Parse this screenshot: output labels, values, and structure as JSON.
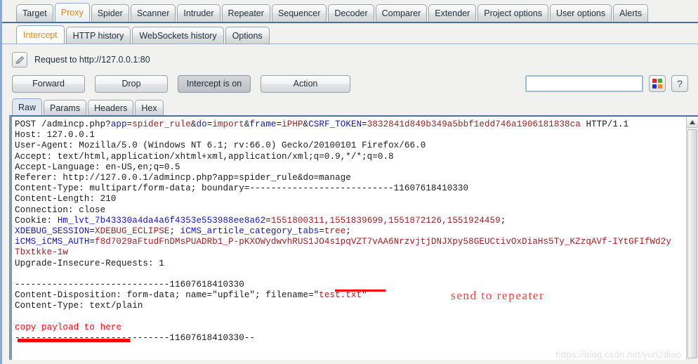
{
  "main_tabs": [
    {
      "label": "Target",
      "active": false
    },
    {
      "label": "Proxy",
      "active": true
    },
    {
      "label": "Spider",
      "active": false
    },
    {
      "label": "Scanner",
      "active": false
    },
    {
      "label": "Intruder",
      "active": false
    },
    {
      "label": "Repeater",
      "active": false
    },
    {
      "label": "Sequencer",
      "active": false
    },
    {
      "label": "Decoder",
      "active": false
    },
    {
      "label": "Comparer",
      "active": false
    },
    {
      "label": "Extender",
      "active": false
    },
    {
      "label": "Project options",
      "active": false
    },
    {
      "label": "User options",
      "active": false
    },
    {
      "label": "Alerts",
      "active": false
    }
  ],
  "sub_tabs": [
    {
      "label": "Intercept",
      "active": true
    },
    {
      "label": "HTTP history",
      "active": false
    },
    {
      "label": "WebSockets history",
      "active": false
    },
    {
      "label": "Options",
      "active": false
    }
  ],
  "toolbar": {
    "request_title": "Request to http://127.0.0.1:80",
    "forward_label": "Forward",
    "drop_label": "Drop",
    "intercept_label": "Intercept is on",
    "action_label": "Action",
    "search_value": "",
    "search_placeholder": "",
    "help_label": "?",
    "palette_colors": [
      "#d42a2a",
      "#46a82c",
      "#2b2bd4",
      "#f08a14"
    ]
  },
  "message_tabs": [
    {
      "label": "Raw",
      "active": true
    },
    {
      "label": "Params",
      "active": false
    },
    {
      "label": "Headers",
      "active": false
    },
    {
      "label": "Hex",
      "active": false
    }
  ],
  "request": {
    "method": "POST",
    "path": "/admincp.php",
    "query_params": [
      {
        "key": "app",
        "value": "spider_rule"
      },
      {
        "key": "do",
        "value": "import"
      },
      {
        "key": "frame",
        "value": "iPHP"
      },
      {
        "key": "CSRF_TOKEN",
        "value": "3832841d849b349a5bbf1edd746a1906181838ca"
      }
    ],
    "http_version": "HTTP/1.1",
    "headers": [
      {
        "name": "Host",
        "value": "127.0.0.1"
      },
      {
        "name": "User-Agent",
        "value": "Mozilla/5.0 (Windows NT 6.1; rv:66.0) Gecko/20100101 Firefox/66.0"
      },
      {
        "name": "Accept",
        "value": "text/html,application/xhtml+xml,application/xml;q=0.9,*/*;q=0.8"
      },
      {
        "name": "Accept-Language",
        "value": "en-US,en;q=0.5"
      },
      {
        "name": "Referer",
        "value": "http://127.0.0.1/admincp.php?app=spider_rule&do=manage"
      },
      {
        "name": "Content-Type",
        "value": "multipart/form-data; boundary=---------------------------11607618410330"
      },
      {
        "name": "Content-Length",
        "value": "210"
      },
      {
        "name": "Connection",
        "value": "close"
      }
    ],
    "cookie_label": "Cookie: ",
    "cookies": [
      {
        "key": "Hm_lvt_7b43330a4da4a6f4353e553988ee8a62",
        "value": "1551800311,1551839699,1551872126,1551924459"
      },
      {
        "key": "XDEBUG_SESSION",
        "value": "XDEBUG_ECLIPSE"
      },
      {
        "key": "iCMS_article_category_tabs",
        "value": "tree"
      },
      {
        "key": "iCMS_iCMS_AUTH",
        "value": "f8d7029aFtudFnDMsPUADRb1_P-pKXOWydwvhRUS1JO4s1pqVZT7vAA6NrzvjtjDNJXpy58GEUCtivOxDiaHs5Ty_KZzqAVf-IYtGFIfWd2yTbxtkke-1w"
      }
    ],
    "upgrade_header": {
      "name": "Upgrade-Insecure-Requests",
      "value": "1"
    },
    "boundary_token": "11607618410330",
    "boundary_dashes": "-----------------------------",
    "body": {
      "disposition_prefix": "Content-Disposition: form-data; name=\"upfile\"; filename=\"",
      "filename": "test.txt",
      "disposition_suffix": "\"",
      "content_type": "Content-Type: text/plain",
      "payload_note": "copy payload to here",
      "closing_suffix": "--"
    }
  },
  "annotations": {
    "send_to_repeater": "send to repeater"
  },
  "watermark": "https://blog.csdn.net/yun2diao"
}
